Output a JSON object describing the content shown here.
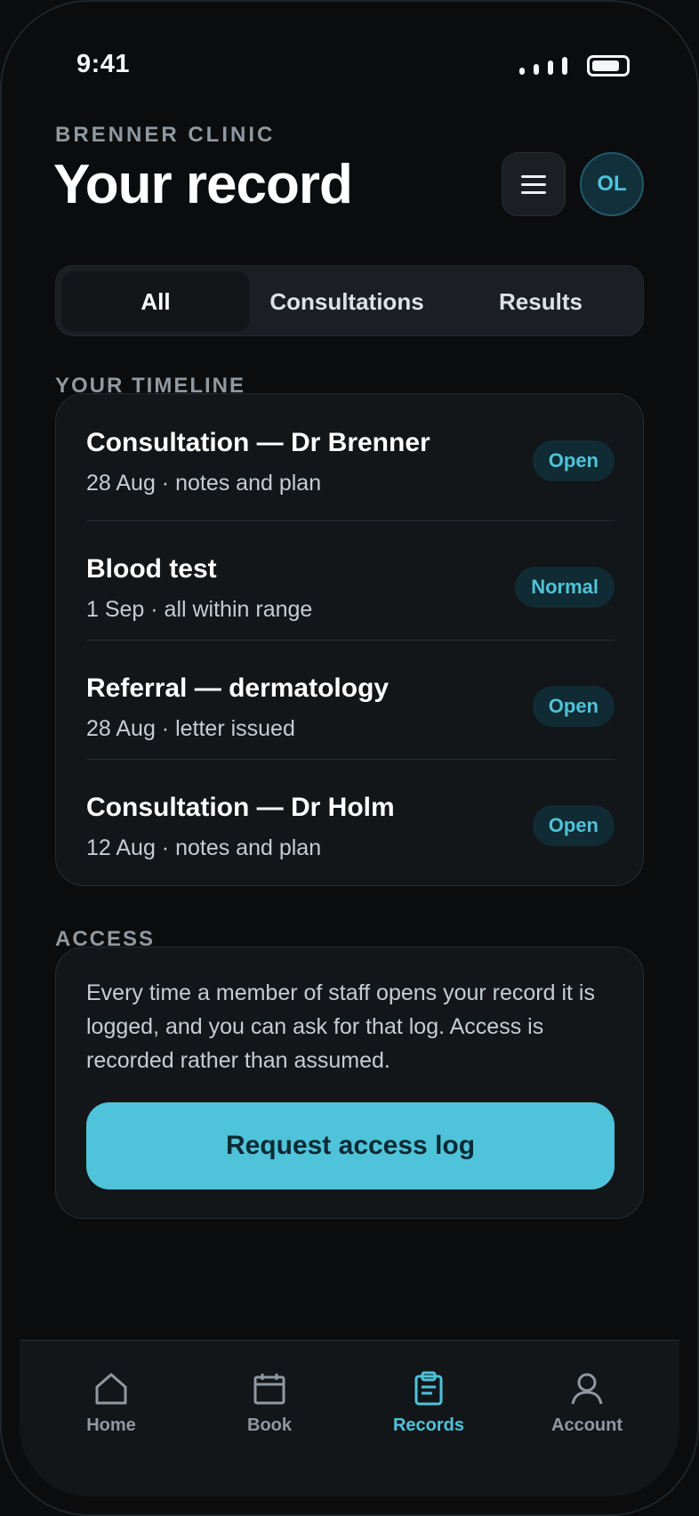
{
  "status_bar": {
    "time": "9:41"
  },
  "header": {
    "clinic": "BRENNER CLINIC",
    "title": "Your record",
    "avatar_initials": "OL"
  },
  "tabs": [
    {
      "label": "All",
      "active": true
    },
    {
      "label": "Consultations",
      "active": false
    },
    {
      "label": "Results",
      "active": false
    }
  ],
  "timeline": {
    "label": "YOUR TIMELINE",
    "items": [
      {
        "title": "Consultation — Dr Brenner",
        "subtitle": "28 Aug · notes and plan",
        "badge": "Open"
      },
      {
        "title": "Blood test",
        "subtitle": "1 Sep · all within range",
        "badge": "Normal"
      },
      {
        "title": "Referral — dermatology",
        "subtitle": "28 Aug · letter issued",
        "badge": "Open"
      },
      {
        "title": "Consultation — Dr Holm",
        "subtitle": "12 Aug · notes and plan",
        "badge": "Open"
      }
    ]
  },
  "access": {
    "label": "ACCESS",
    "text": "Every time a member of staff opens your record it is logged, and you can ask for that log. Access is recorded rather than assumed.",
    "button": "Request access log"
  },
  "nav": [
    {
      "label": "Home",
      "icon": "home-icon",
      "active": false
    },
    {
      "label": "Book",
      "icon": "calendar-icon",
      "active": false
    },
    {
      "label": "Records",
      "icon": "clipboard-icon",
      "active": true
    },
    {
      "label": "Account",
      "icon": "person-icon",
      "active": false
    }
  ],
  "colors": {
    "accent": "#4fc3d9",
    "background": "#0a0c0e",
    "card": "#121619",
    "badge_bg": "#102b33"
  }
}
